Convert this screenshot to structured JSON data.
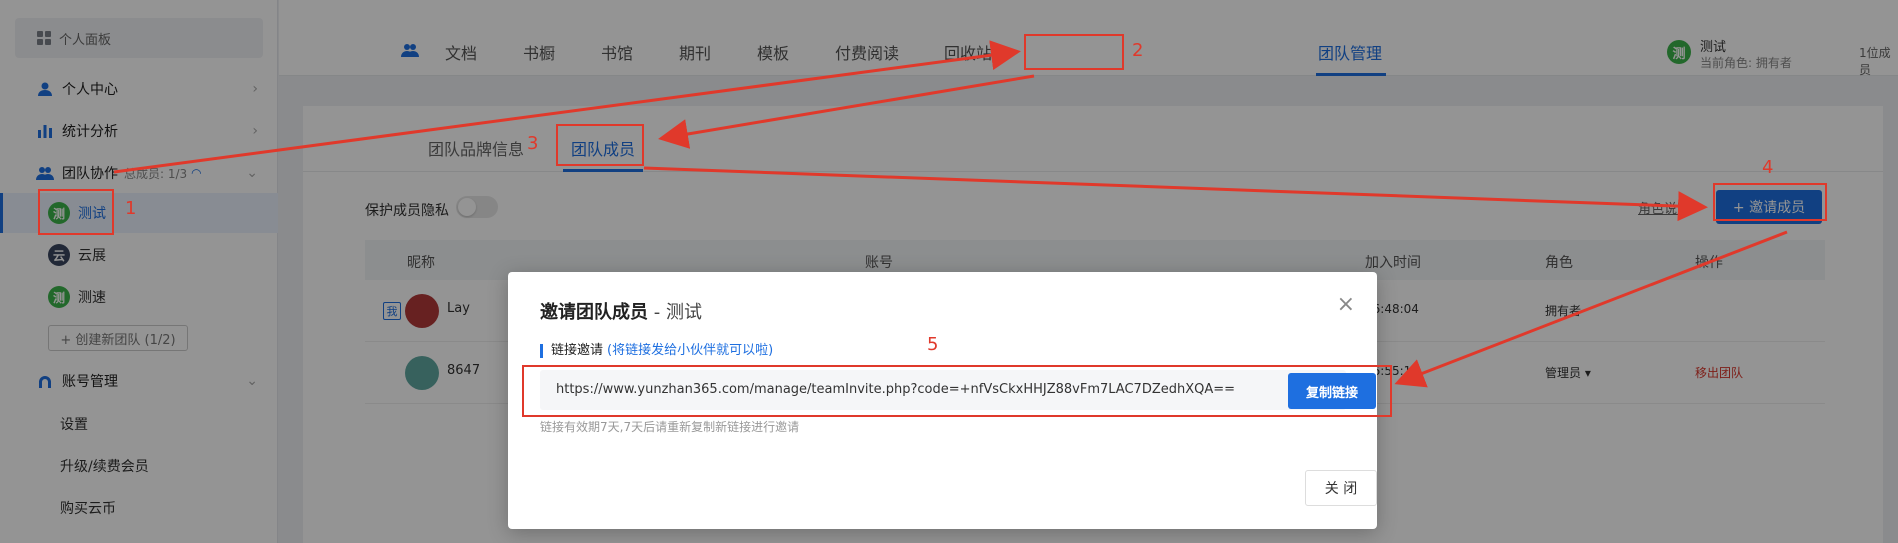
{
  "sidebar": {
    "panel_label": "个人面板",
    "items": [
      {
        "label": "个人中心"
      },
      {
        "label": "统计分析"
      },
      {
        "label": "团队协作",
        "sub": "总成员: 1/3"
      }
    ],
    "teams": [
      {
        "avatar": "测",
        "label": "测试"
      },
      {
        "avatar": "云",
        "label": "云展"
      },
      {
        "avatar": "测",
        "label": "测速"
      }
    ],
    "create_team": "+ 创建新团队 (1/2)",
    "account": {
      "label": "账号管理"
    },
    "account_items": [
      "设置",
      "升级/续费会员",
      "购买云币"
    ]
  },
  "topnav": {
    "tabs": [
      "文档",
      "书橱",
      "书馆",
      "期刊",
      "模板",
      "付费阅读",
      "回收站",
      "团队管理"
    ],
    "active": "团队管理",
    "member_count": "1位成员",
    "user_avatar": "测",
    "user_name": "测试",
    "user_role": "当前角色: 拥有者"
  },
  "content": {
    "sub_tabs": [
      "团队品牌信息",
      "团队成员"
    ],
    "privacy_label": "保护成员隐私",
    "role_desc": "角色说明",
    "invite_button": "+ 邀请成员",
    "table": {
      "headers": [
        "昵称",
        "账号",
        "加入时间",
        "角色",
        "操作"
      ],
      "rows": [
        {
          "tag": "我",
          "name": "Lay",
          "time": "16:48:04",
          "role": "拥有者",
          "action": ""
        },
        {
          "tag": "",
          "name": "8647",
          "time": "16:55:17",
          "role": "管理员 ▾",
          "action": "移出团队"
        }
      ]
    }
  },
  "modal": {
    "title": "邀请团队成员",
    "team": " - 测试",
    "link_label": "链接邀请",
    "link_hint": "(将链接发给小伙伴就可以啦)",
    "link": "https://www.yunzhan365.com/manage/teamInvite.php?code=+nfVsCkxHHJZ88vFm7LAC7DZedhXQA==",
    "copy_button": "复制链接",
    "expiry": "链接有效期7天,7天后请重新复制新链接进行邀请",
    "close_button": "关 闭"
  },
  "annotations": [
    "1",
    "2",
    "3",
    "4",
    "5"
  ],
  "colors": {
    "accent": "#1e6fe0",
    "annotation": "#e0392b",
    "green_avatar": "#3cb34a"
  }
}
